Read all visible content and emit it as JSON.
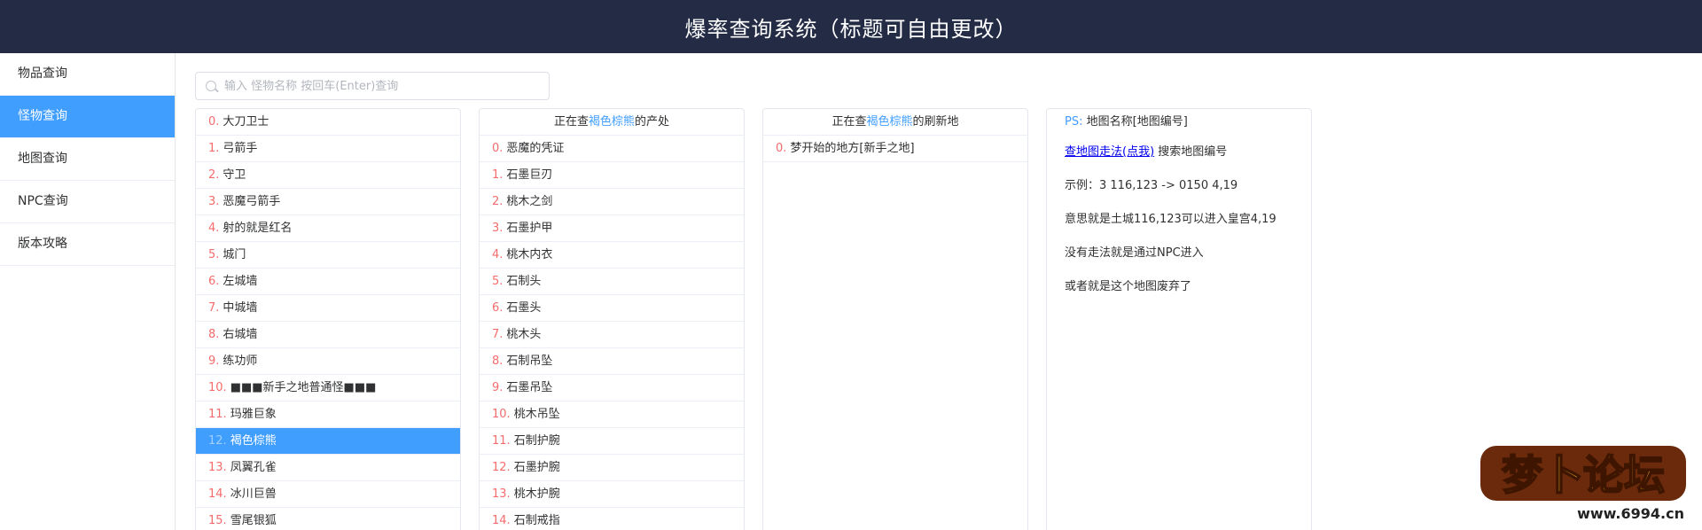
{
  "header": {
    "title": "爆率查询系统（标题可自由更改）"
  },
  "sidebar": {
    "items": [
      {
        "label": "物品查询",
        "active": false
      },
      {
        "label": "怪物查询",
        "active": true
      },
      {
        "label": "地图查询",
        "active": false
      },
      {
        "label": "NPC查询",
        "active": false
      },
      {
        "label": "版本攻略",
        "active": false
      }
    ]
  },
  "search": {
    "placeholder": "输入 怪物名称 按回车(Enter)查询",
    "value": ""
  },
  "monsters": {
    "selected_index": 12,
    "items": [
      {
        "idx": "0.",
        "name": "大刀卫士"
      },
      {
        "idx": "1.",
        "name": "弓箭手"
      },
      {
        "idx": "2.",
        "name": "守卫"
      },
      {
        "idx": "3.",
        "name": "恶魔弓箭手"
      },
      {
        "idx": "4.",
        "name": "射的就是红名"
      },
      {
        "idx": "5.",
        "name": "城门"
      },
      {
        "idx": "6.",
        "name": "左城墙"
      },
      {
        "idx": "7.",
        "name": "中城墙"
      },
      {
        "idx": "8.",
        "name": "右城墙"
      },
      {
        "idx": "9.",
        "name": "练功师"
      },
      {
        "idx": "10.",
        "name": "■■■新手之地普通怪■■■"
      },
      {
        "idx": "11.",
        "name": "玛雅巨象"
      },
      {
        "idx": "12.",
        "name": "褐色棕熊"
      },
      {
        "idx": "13.",
        "name": "凤翼孔雀"
      },
      {
        "idx": "14.",
        "name": "冰川巨兽"
      },
      {
        "idx": "15.",
        "name": "雪尾银狐"
      }
    ]
  },
  "drops": {
    "header_prefix": "正在查",
    "header_name": "褐色棕熊",
    "header_suffix": "的产处",
    "items": [
      {
        "idx": "0.",
        "name": "恶魔的凭证"
      },
      {
        "idx": "1.",
        "name": "石墨巨刃"
      },
      {
        "idx": "2.",
        "name": "桃木之剑"
      },
      {
        "idx": "3.",
        "name": "石墨护甲"
      },
      {
        "idx": "4.",
        "name": "桃木内衣"
      },
      {
        "idx": "5.",
        "name": "石制头"
      },
      {
        "idx": "6.",
        "name": "石墨头"
      },
      {
        "idx": "7.",
        "name": "桃木头"
      },
      {
        "idx": "8.",
        "name": "石制吊坠"
      },
      {
        "idx": "9.",
        "name": "石墨吊坠"
      },
      {
        "idx": "10.",
        "name": "桃木吊坠"
      },
      {
        "idx": "11.",
        "name": "石制护腕"
      },
      {
        "idx": "12.",
        "name": "石墨护腕"
      },
      {
        "idx": "13.",
        "name": "桃木护腕"
      },
      {
        "idx": "14.",
        "name": "石制戒指"
      }
    ]
  },
  "spawns": {
    "header_prefix": "正在查",
    "header_name": "褐色棕熊",
    "header_suffix": "的刷新地",
    "items": [
      {
        "idx": "0.",
        "name": "梦开始的地方[新手之地]"
      }
    ]
  },
  "info": {
    "ps_label": "PS:",
    "ps_text": "地图名称[地图编号]",
    "link_text": "查地图走法(点我)",
    "link_suffix": "搜索地图编号",
    "example": "示例：3 116,123 -> 0150 4,19",
    "meaning": "意思就是土城116,123可以进入皇宫4,19",
    "no_path": "没有走法就是通过NPC进入",
    "abandoned": "或者就是这个地图废弃了"
  },
  "watermark": {
    "logo_text": "梦卜论坛",
    "url": "www.6994.cn"
  },
  "colors": {
    "header_bg": "#232b45",
    "accent": "#409eff",
    "index_red": "#f56c6c"
  }
}
